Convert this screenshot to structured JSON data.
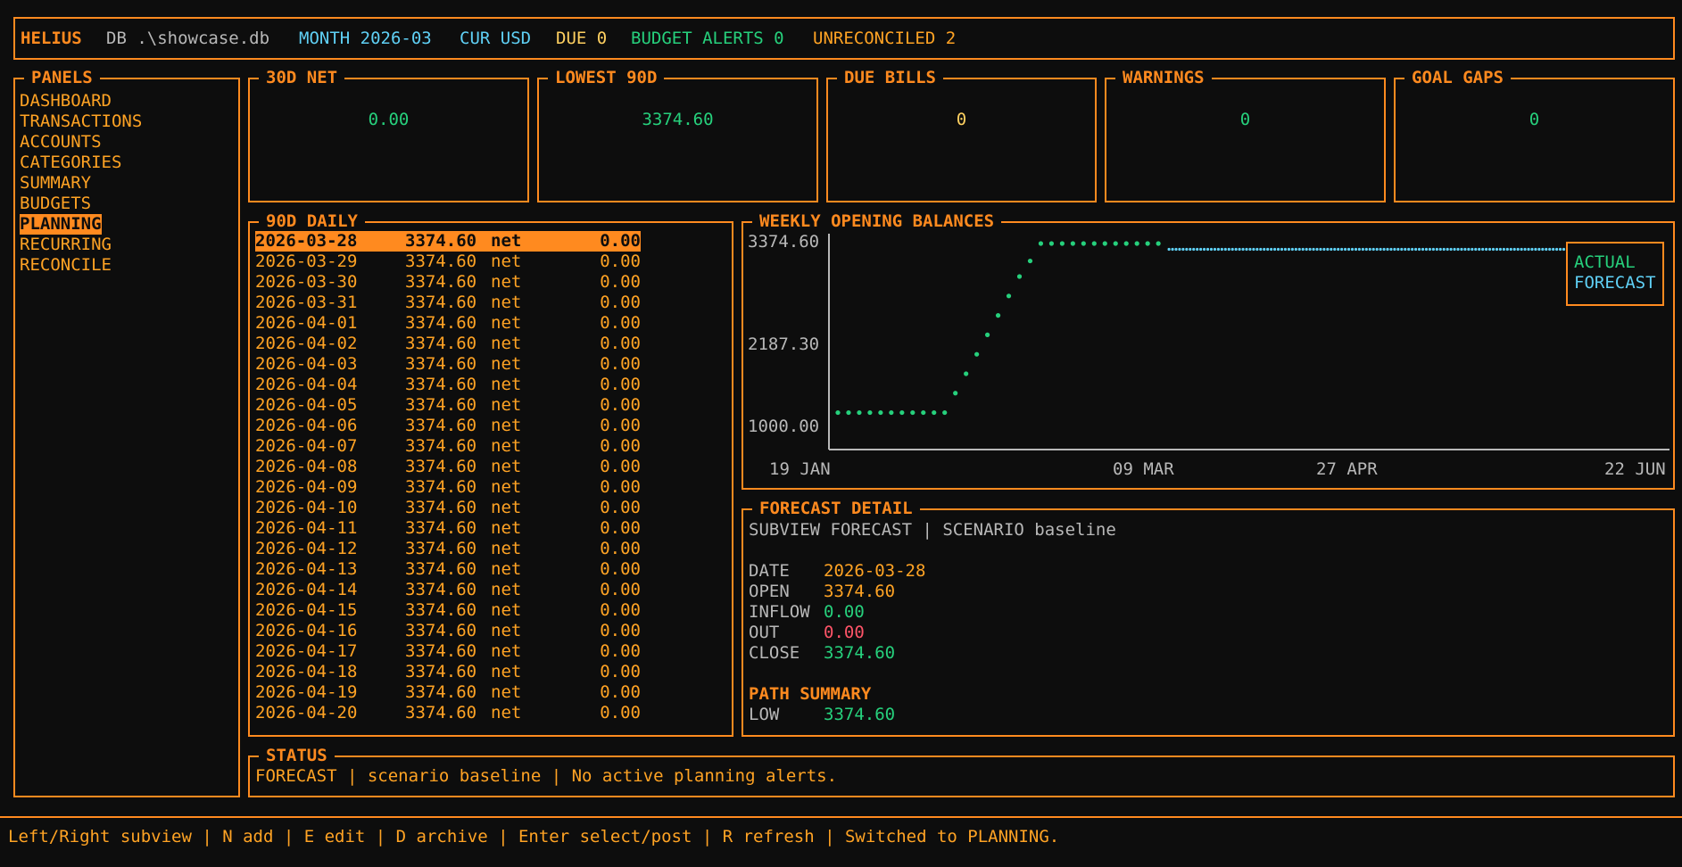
{
  "topbar": {
    "app": "HELIUS",
    "db": "DB .\\showcase.db",
    "month": "MONTH 2026-03",
    "currency": "CUR USD",
    "due": "DUE 0",
    "budget_alerts": "BUDGET ALERTS 0",
    "unreconciled": "UNRECONCILED 2"
  },
  "panels": {
    "title": "PANELS",
    "items": [
      "DASHBOARD",
      "TRANSACTIONS",
      "ACCOUNTS",
      "CATEGORIES",
      "SUMMARY",
      "BUDGETS",
      "PLANNING",
      "RECURRING",
      "RECONCILE"
    ],
    "selected": "PLANNING"
  },
  "stats": [
    {
      "title": "30D NET",
      "value": "0.00"
    },
    {
      "title": "LOWEST 90D",
      "value": "3374.60"
    },
    {
      "title": "DUE BILLS",
      "value": "0"
    },
    {
      "title": "WARNINGS",
      "value": "0"
    },
    {
      "title": "GOAL GAPS",
      "value": "0"
    }
  ],
  "daily": {
    "title": "90D DAILY",
    "rows": [
      {
        "date": "2026-03-28",
        "balance": "3374.60",
        "label": "net",
        "net": "0.00"
      },
      {
        "date": "2026-03-29",
        "balance": "3374.60",
        "label": "net",
        "net": "0.00"
      },
      {
        "date": "2026-03-30",
        "balance": "3374.60",
        "label": "net",
        "net": "0.00"
      },
      {
        "date": "2026-03-31",
        "balance": "3374.60",
        "label": "net",
        "net": "0.00"
      },
      {
        "date": "2026-04-01",
        "balance": "3374.60",
        "label": "net",
        "net": "0.00"
      },
      {
        "date": "2026-04-02",
        "balance": "3374.60",
        "label": "net",
        "net": "0.00"
      },
      {
        "date": "2026-04-03",
        "balance": "3374.60",
        "label": "net",
        "net": "0.00"
      },
      {
        "date": "2026-04-04",
        "balance": "3374.60",
        "label": "net",
        "net": "0.00"
      },
      {
        "date": "2026-04-05",
        "balance": "3374.60",
        "label": "net",
        "net": "0.00"
      },
      {
        "date": "2026-04-06",
        "balance": "3374.60",
        "label": "net",
        "net": "0.00"
      },
      {
        "date": "2026-04-07",
        "balance": "3374.60",
        "label": "net",
        "net": "0.00"
      },
      {
        "date": "2026-04-08",
        "balance": "3374.60",
        "label": "net",
        "net": "0.00"
      },
      {
        "date": "2026-04-09",
        "balance": "3374.60",
        "label": "net",
        "net": "0.00"
      },
      {
        "date": "2026-04-10",
        "balance": "3374.60",
        "label": "net",
        "net": "0.00"
      },
      {
        "date": "2026-04-11",
        "balance": "3374.60",
        "label": "net",
        "net": "0.00"
      },
      {
        "date": "2026-04-12",
        "balance": "3374.60",
        "label": "net",
        "net": "0.00"
      },
      {
        "date": "2026-04-13",
        "balance": "3374.60",
        "label": "net",
        "net": "0.00"
      },
      {
        "date": "2026-04-14",
        "balance": "3374.60",
        "label": "net",
        "net": "0.00"
      },
      {
        "date": "2026-04-15",
        "balance": "3374.60",
        "label": "net",
        "net": "0.00"
      },
      {
        "date": "2026-04-16",
        "balance": "3374.60",
        "label": "net",
        "net": "0.00"
      },
      {
        "date": "2026-04-17",
        "balance": "3374.60",
        "label": "net",
        "net": "0.00"
      },
      {
        "date": "2026-04-18",
        "balance": "3374.60",
        "label": "net",
        "net": "0.00"
      },
      {
        "date": "2026-04-19",
        "balance": "3374.60",
        "label": "net",
        "net": "0.00"
      },
      {
        "date": "2026-04-20",
        "balance": "3374.60",
        "label": "net",
        "net": "0.00"
      }
    ]
  },
  "weekly": {
    "title": "WEEKLY OPENING BALANCES"
  },
  "chart_data": {
    "type": "scatter",
    "title": "WEEKLY OPENING BALANCES",
    "y_tick_labels": [
      "3374.60",
      "2187.30",
      "1000.00"
    ],
    "x_tick_labels": [
      "19 JAN",
      "09 MAR",
      "27 APR",
      "22 JUN"
    ],
    "ylim": [
      1000.0,
      3374.6
    ],
    "legend": [
      "ACTUAL",
      "FORECAST"
    ],
    "legend_placement": "top-right",
    "grid": false,
    "series": [
      {
        "name": "ACTUAL",
        "color": "#26d07c",
        "x": [
          0,
          1,
          2,
          3,
          4,
          5,
          6,
          7,
          8,
          9,
          10,
          11,
          12,
          13,
          14,
          15,
          16,
          17,
          18,
          19,
          20,
          21,
          22,
          23,
          24,
          25,
          26,
          27,
          28,
          29,
          30
        ],
        "y": [
          1200,
          1200,
          1200,
          1200,
          1200,
          1200,
          1200,
          1200,
          1200,
          1200,
          1200,
          1450,
          1700,
          1950,
          2200,
          2450,
          2700,
          2950,
          3150,
          3374.6,
          3374.6,
          3374.6,
          3374.6,
          3374.6,
          3374.6,
          3374.6,
          3374.6,
          3374.6,
          3374.6,
          3374.6,
          3374.6
        ]
      },
      {
        "name": "FORECAST",
        "color": "#5fd0f5",
        "x_range": [
          31,
          68
        ],
        "y": 3300
      }
    ]
  },
  "forecast": {
    "title": "FORECAST DETAIL",
    "subview": "SUBVIEW FORECAST | SCENARIO baseline",
    "date_label": "DATE",
    "date": "2026-03-28",
    "open_label": "OPEN",
    "open": "3374.60",
    "inflow_label": "INFLOW",
    "inflow": "0.00",
    "out_label": "OUT",
    "out": "0.00",
    "close_label": "CLOSE",
    "close": "3374.60",
    "path_title": "PATH SUMMARY",
    "low_label": "LOW",
    "low": "3374.60"
  },
  "status": {
    "title": "STATUS",
    "text": "FORECAST | scenario baseline | No active planning alerts."
  },
  "footer": {
    "text": "Left/Right subview | N add | E edit | D archive | Enter select/post | R refresh | Switched to PLANNING."
  },
  "colors": {
    "accent": "#ff8a1f",
    "positive": "#26d07c",
    "forecast": "#5fd0f5",
    "negative": "#ff5468"
  }
}
